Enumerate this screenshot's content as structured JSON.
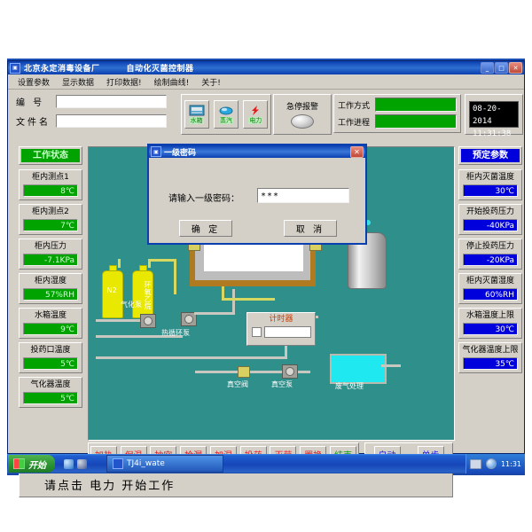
{
  "window": {
    "title": "北京永定消毒设备厂",
    "subtitle": "自动化灭菌控制器",
    "icon": "app-icon",
    "minimize": "_",
    "maximize": "□",
    "close": "✕"
  },
  "menu": {
    "items": [
      {
        "label": "设置参数"
      },
      {
        "label": "显示数据"
      },
      {
        "label": "打印数据!"
      },
      {
        "label": "绘制曲线!"
      },
      {
        "label": "关于!"
      }
    ]
  },
  "header": {
    "fields": [
      {
        "label": "编 号",
        "value": "",
        "placeholder": ""
      },
      {
        "label": "文件名",
        "value": "",
        "placeholder": ""
      }
    ],
    "toolbar_buttons": [
      {
        "label": "水箱",
        "icon": "water-tank-icon"
      },
      {
        "label": "蒸汽",
        "icon": "steam-icon"
      },
      {
        "label": "电力",
        "icon": "power-bolt-icon"
      }
    ],
    "alarm": {
      "label": "急停报警",
      "icon": "emergency-stop-lamp"
    },
    "mode": {
      "rows": [
        {
          "label": "工作方式",
          "value": ""
        },
        {
          "label": "工作进程",
          "value": ""
        }
      ]
    },
    "clock": {
      "date": "08-20-2014",
      "time": "11:31:38"
    }
  },
  "left_panel": {
    "title": "工作状态",
    "items": [
      {
        "name": "柜内测点1",
        "value": "8℃"
      },
      {
        "name": "柜内测点2",
        "value": "7℃"
      },
      {
        "name": "柜内压力",
        "value": "-7.1KPa"
      },
      {
        "name": "柜内湿度",
        "value": "57%RH"
      },
      {
        "name": "水箱温度",
        "value": "9℃"
      },
      {
        "name": "投药口温度",
        "value": "5℃"
      },
      {
        "name": "气化器温度",
        "value": "5℃"
      }
    ]
  },
  "right_panel": {
    "title": "预定参数",
    "items": [
      {
        "name": "柜内灭菌温度",
        "value": "30℃"
      },
      {
        "name": "开始投药压力",
        "value": "-40KPa"
      },
      {
        "name": "停止投药压力",
        "value": "-20KPa"
      },
      {
        "name": "柜内灭菌湿度",
        "value": "60%RH"
      },
      {
        "name": "水箱温度上限",
        "value": "30℃"
      },
      {
        "name": "气化器温度上限",
        "value": "35℃"
      }
    ]
  },
  "schematic": {
    "cylinders": [
      {
        "label": "N2"
      },
      {
        "label": "环氧乙烷"
      }
    ],
    "labels": [
      {
        "text": "气化泵"
      },
      {
        "text": "热循环泵"
      },
      {
        "text": "真空阀"
      },
      {
        "text": "真空泵"
      },
      {
        "text": "废气处理"
      }
    ],
    "timer": {
      "title": "计时器",
      "value": ""
    }
  },
  "actions": {
    "process_buttons": [
      {
        "label": "加热",
        "color": "red"
      },
      {
        "label": "保温",
        "color": "red"
      },
      {
        "label": "抽空",
        "color": "red"
      },
      {
        "label": "检漏",
        "color": "red"
      },
      {
        "label": "加湿",
        "color": "red"
      },
      {
        "label": "投药",
        "color": "red"
      },
      {
        "label": "灭菌",
        "color": "red"
      },
      {
        "label": "置换",
        "color": "red"
      },
      {
        "label": "结束",
        "color": "green"
      }
    ],
    "mode_buttons": [
      {
        "label": "自动",
        "color": "blue"
      },
      {
        "label": "单步",
        "color": "blue"
      }
    ]
  },
  "status": {
    "message": "请点击  电力  开始工作"
  },
  "dialog": {
    "title": "一级密码",
    "icon": "dialog-icon",
    "close": "✕",
    "prompt": "请输入一级密码：",
    "password_value": "***",
    "password_placeholder": "",
    "ok_label": "确 定",
    "cancel_label": "取 消"
  },
  "taskbar": {
    "start_label": "开始",
    "task_label": "TJ4i_wate",
    "tray_time": "11:31"
  },
  "colors": {
    "accent_blue": "#0000dd",
    "status_green": "#00a300",
    "schematic_bg": "#2f8f8a",
    "window_face": "#d4d0c8",
    "action_red": "#e02020"
  }
}
